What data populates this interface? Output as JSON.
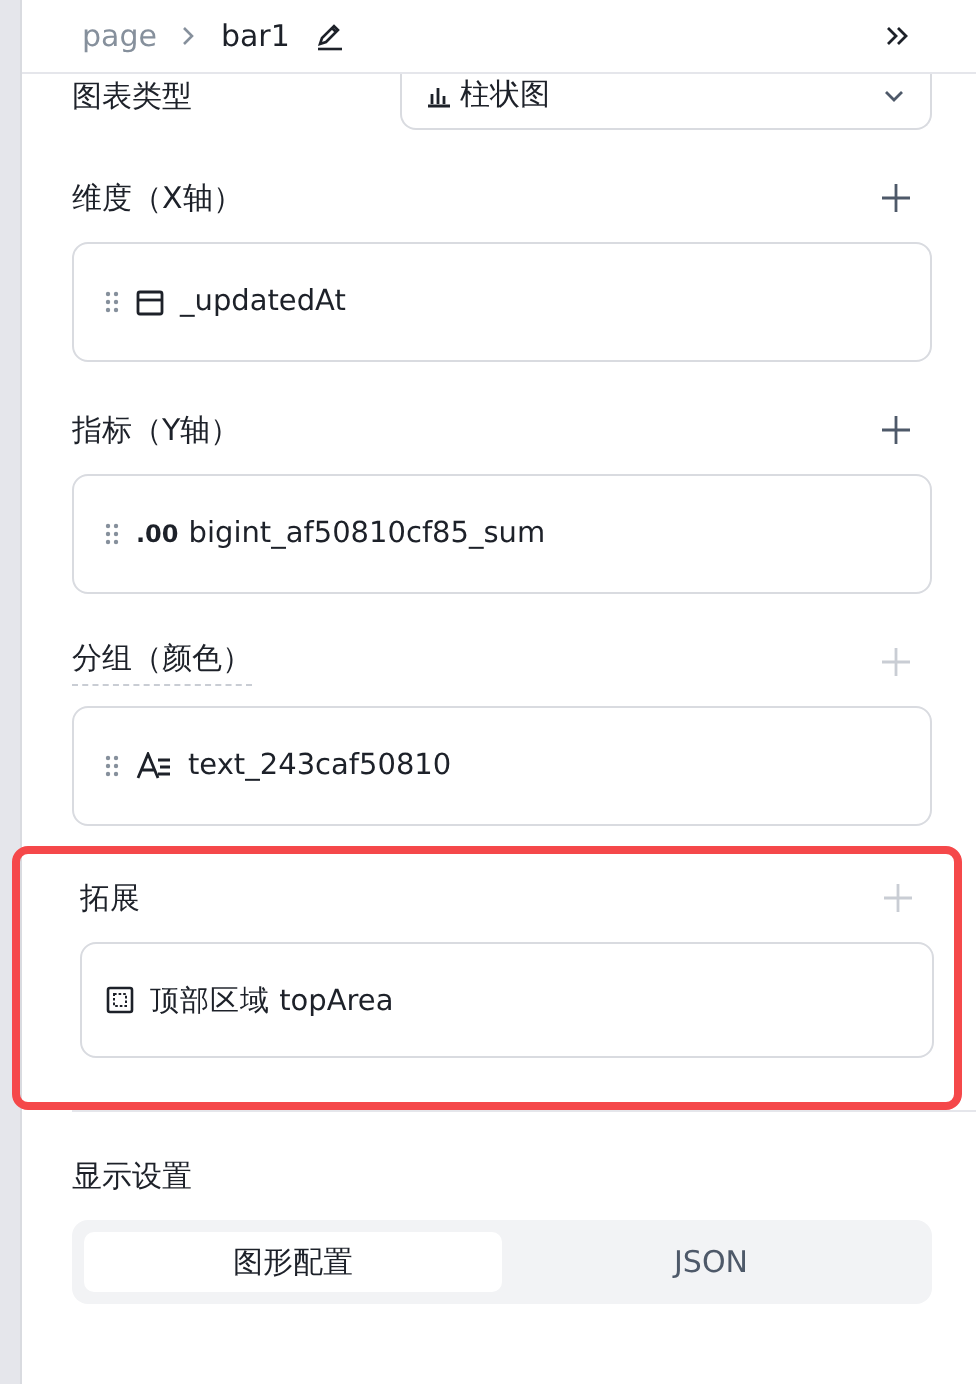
{
  "breadcrumb": {
    "items": [
      {
        "label": "page",
        "current": false
      },
      {
        "label": "bar1",
        "current": true
      }
    ]
  },
  "chart_type": {
    "label": "图表类型",
    "value": "柱状图"
  },
  "sections": [
    {
      "title": "维度（X轴）",
      "add_disabled": false,
      "dashed_title": false,
      "highlighted": false,
      "field": {
        "draggable": true,
        "kind": "date",
        "name": "_updatedAt"
      }
    },
    {
      "title": "指标（Y轴）",
      "add_disabled": false,
      "dashed_title": false,
      "highlighted": false,
      "field": {
        "draggable": true,
        "kind": "number",
        "name": "bigint_af50810cf85_sum",
        "type_label": ".00"
      }
    },
    {
      "title": "分组（颜色）",
      "add_disabled": true,
      "dashed_title": true,
      "highlighted": false,
      "field": {
        "draggable": true,
        "kind": "text",
        "name": "text_243caf50810"
      }
    },
    {
      "title": "拓展",
      "add_disabled": true,
      "dashed_title": false,
      "highlighted": true,
      "field": {
        "draggable": false,
        "kind": "area",
        "name": "顶部区域 topArea"
      }
    }
  ],
  "display": {
    "title": "显示设置",
    "tabs": [
      {
        "label": "图形配置",
        "selected": true
      },
      {
        "label": "JSON",
        "selected": false
      }
    ]
  }
}
